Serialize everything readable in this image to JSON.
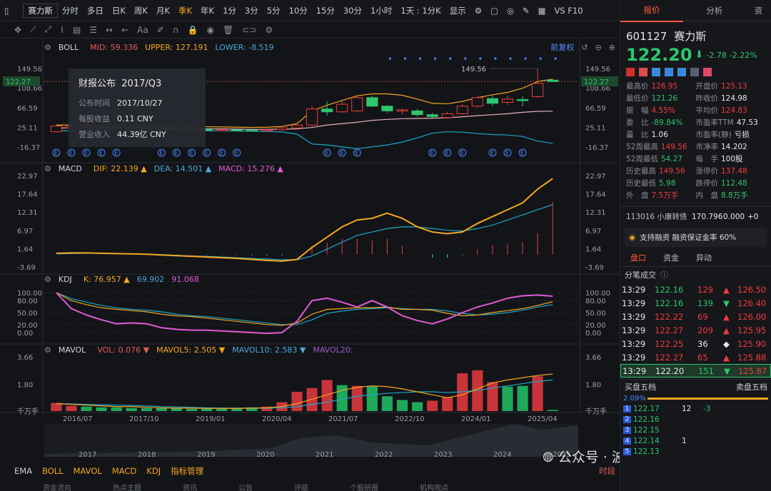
{
  "topbar": {
    "stock_name": "赛力斯",
    "periods": [
      "分时",
      "多日",
      "日K",
      "周K",
      "月K",
      "季K",
      "年K",
      "1分",
      "3分",
      "5分",
      "10分",
      "15分",
      "30分",
      "1小时",
      "1天 : 1分K",
      "显示"
    ],
    "active_period": "季K",
    "vs_label": "VS F10"
  },
  "toolbar": {
    "aa_label": "Aa"
  },
  "boll": {
    "name": "BOLL",
    "mid_label": "MID:",
    "mid": "59.336",
    "upper_label": "UPPER:",
    "upper": "127.191",
    "lower_label": "LOWER:",
    "lower": "-8.519",
    "fq_label": "前复权"
  },
  "tooltip": {
    "title": "财报公布",
    "period": "2017/Q3",
    "rows": [
      [
        "公布时间",
        "2017/10/27"
      ],
      [
        "每股收益",
        "0.11 CNY"
      ],
      [
        "营业收入",
        "44.39亿 CNY"
      ]
    ]
  },
  "macd": {
    "name": "MACD",
    "dif_label": "DIF:",
    "dif": "22.139",
    "dea_label": "DEA:",
    "dea": "14.501",
    "macd_label": "MACD:",
    "macd": "15.276"
  },
  "kdj": {
    "name": "KDJ",
    "k_label": "K:",
    "k": "76.957",
    "d": "69.902",
    "j": "91.068"
  },
  "mavol": {
    "name": "MAVOL",
    "vol_label": "VOL:",
    "vol": "0.076",
    "ma5_label": "MAVOL5:",
    "ma5": "2.505",
    "ma10_label": "MAVOL10:",
    "ma10": "2.583",
    "ma20_label": "MAVOL20:",
    "unit": "千万手"
  },
  "axes": {
    "price_ticks": [
      "149.56",
      "122.27",
      "108.66",
      "66.59",
      "25.11",
      "-16.37"
    ],
    "price_marker": "122.27",
    "peak_label": "149.56",
    "macd_ticks": [
      "22.97",
      "17.64",
      "12.31",
      "6.97",
      "1.64",
      "-3.69"
    ],
    "kdj_ticks": [
      "100.00",
      "80.00",
      "50.00",
      "20.00",
      "0.00"
    ],
    "vol_ticks": [
      "3.66",
      "1.80",
      "千万手"
    ],
    "date_ticks": [
      "2016/07",
      "2017/10",
      "2019/01",
      "2020/04",
      "2021/07",
      "2022/10",
      "2024/01",
      "2025/04"
    ],
    "nav_years": [
      "2017",
      "2018",
      "2019",
      "2020",
      "2021",
      "2022",
      "2023",
      "2024",
      "2025"
    ]
  },
  "bottombar": {
    "items": [
      "EMA",
      "BOLL",
      "MAVOL",
      "MACD",
      "KDJ",
      "指标管理"
    ],
    "right_label": "时段"
  },
  "bottom_tabs": [
    "资金流向",
    "热点主题",
    "资讯",
    "公告",
    "评级",
    "个股研报",
    "机构观点"
  ],
  "watermark": "公众号 · 波段肺鱼",
  "right": {
    "tabs": [
      "报价",
      "分析",
      "资"
    ],
    "code": "601127",
    "name": "赛力斯",
    "price": "122.20",
    "arrow": "⬇",
    "change": "-2.78",
    "change_pct": "-2.22%",
    "quote": [
      [
        "最高价",
        "126.95",
        "red",
        "开盘价",
        "125.13",
        "red"
      ],
      [
        "最低价",
        "121.26",
        "green",
        "昨收价",
        "124.98",
        "white"
      ],
      [
        "振　幅",
        "4.55%",
        "red",
        "平均价",
        "124.83",
        "red"
      ],
      [
        "委　比",
        "-89.84%",
        "green",
        "市盈率TTM",
        "47.53",
        "white"
      ],
      [
        "量　比",
        "1.06",
        "white",
        "市盈率(静)",
        "亏损",
        "white"
      ],
      [
        "52周最高",
        "149.56",
        "red",
        "市净率",
        "14.202",
        "white"
      ],
      [
        "52周最低",
        "54.27",
        "green",
        "每　手",
        "100股",
        "white"
      ],
      [
        "历史最高",
        "149.56",
        "red",
        "涨停价",
        "137.48",
        "red"
      ],
      [
        "历史最低",
        "5.98",
        "green",
        "跌停价",
        "112.48",
        "green"
      ],
      [
        "外　盘",
        "7.5万手",
        "red",
        "内　盘",
        "8.8万手",
        "green"
      ]
    ],
    "bond": [
      "113016 小康转债",
      "170.796",
      "0.000",
      "+0"
    ],
    "margin_text": "支持融资 融资保证金率 60%",
    "subtabs": [
      "盘口",
      "资金",
      "异动"
    ],
    "trades_title": "分笔成交",
    "trades": [
      [
        "13:29",
        "122.16",
        "129",
        "▲",
        "126.50"
      ],
      [
        "13:29",
        "122.16",
        "139",
        "▼",
        "126.40"
      ],
      [
        "13:29",
        "122.22",
        "69",
        "▲",
        "126.00"
      ],
      [
        "13:29",
        "122.27",
        "209",
        "▲",
        "125.95"
      ],
      [
        "13:29",
        "122.25",
        "36",
        "◆",
        "125.90"
      ],
      [
        "13:29",
        "122.27",
        "65",
        "▲",
        "125.88"
      ],
      [
        "13:29",
        "122.20",
        "151",
        "▼",
        "125.87"
      ]
    ],
    "bid_title": "买盘五档",
    "ask_title": "卖盘五档",
    "bid_ratio": "2.09%",
    "bids": [
      [
        "1",
        "122.17",
        "12",
        "-3"
      ],
      [
        "2",
        "122.16",
        "",
        ""
      ],
      [
        "3",
        "122.15",
        "",
        ""
      ],
      [
        "4",
        "122.14",
        "1",
        ""
      ],
      [
        "5",
        "122.13",
        "",
        ""
      ]
    ]
  },
  "chart_data": {
    "type": "candlestick",
    "candles": [
      {
        "o": 16,
        "c": 28,
        "h": 30,
        "l": 14
      },
      {
        "o": 24,
        "c": 27,
        "h": 29,
        "l": 22
      },
      {
        "o": 26,
        "c": 26.5,
        "h": 28,
        "l": 24
      },
      {
        "o": 26,
        "c": 25.5,
        "h": 27,
        "l": 24
      },
      {
        "o": 25,
        "c": 24.5,
        "h": 26,
        "l": 23
      },
      {
        "o": 24,
        "c": 24,
        "h": 25,
        "l": 23
      },
      {
        "o": 24,
        "c": 23,
        "h": 25,
        "l": 22
      },
      {
        "o": 23,
        "c": 22,
        "h": 24,
        "l": 21
      },
      {
        "o": 22,
        "c": 21.5,
        "h": 23,
        "l": 20
      },
      {
        "o": 21,
        "c": 21,
        "h": 22,
        "l": 20
      },
      {
        "o": 21,
        "c": 20,
        "h": 22,
        "l": 19
      },
      {
        "o": 20,
        "c": 20.5,
        "h": 21.5,
        "l": 19
      },
      {
        "o": 20,
        "c": 19.5,
        "h": 21,
        "l": 18.5
      },
      {
        "o": 19.5,
        "c": 19,
        "h": 20.5,
        "l": 18
      },
      {
        "o": 19,
        "c": 20,
        "h": 21,
        "l": 18.5
      },
      {
        "o": 20,
        "c": 24,
        "h": 25,
        "l": 19
      },
      {
        "o": 24,
        "c": 30,
        "h": 32,
        "l": 23
      },
      {
        "o": 30,
        "c": 64,
        "h": 70,
        "l": 28
      },
      {
        "o": 64,
        "c": 58,
        "h": 80,
        "l": 50
      },
      {
        "o": 58,
        "c": 74,
        "h": 80,
        "l": 56
      },
      {
        "o": 60,
        "c": 88,
        "h": 94,
        "l": 57
      },
      {
        "o": 88,
        "c": 70,
        "h": 92,
        "l": 68
      },
      {
        "o": 70,
        "c": 60,
        "h": 72,
        "l": 56
      },
      {
        "o": 60,
        "c": 62,
        "h": 66,
        "l": 52
      },
      {
        "o": 60,
        "c": 52,
        "h": 64,
        "l": 48
      },
      {
        "o": 52,
        "c": 48,
        "h": 56,
        "l": 45
      },
      {
        "o": 46,
        "c": 54,
        "h": 58,
        "l": 44
      },
      {
        "o": 54,
        "c": 70,
        "h": 74,
        "l": 52
      },
      {
        "o": 70,
        "c": 88,
        "h": 92,
        "l": 66
      },
      {
        "o": 86,
        "c": 76,
        "h": 94,
        "l": 70
      },
      {
        "o": 78,
        "c": 85,
        "h": 92,
        "l": 72
      },
      {
        "o": 84,
        "c": 82,
        "h": 90,
        "l": 70
      },
      {
        "o": 90,
        "c": 118,
        "h": 150,
        "l": 88
      },
      {
        "o": 125,
        "c": 122,
        "h": 127,
        "l": 121
      }
    ],
    "boll_mid": [
      24,
      24,
      24.5,
      24.5,
      24.3,
      24.2,
      24,
      23.5,
      23,
      22.5,
      22.2,
      22,
      21.5,
      21,
      21,
      21.3,
      22,
      25,
      30,
      33,
      36,
      40,
      42,
      43.5,
      44,
      44.5,
      45.5,
      47.5,
      50,
      52,
      54,
      57,
      59,
      59.3
    ],
    "boll_upper": [
      30,
      30,
      29.5,
      29,
      29,
      28.5,
      28,
      27.5,
      27,
      27,
      26.5,
      26,
      25.5,
      25,
      25.5,
      27,
      33,
      60,
      72,
      82,
      92,
      96,
      96,
      93,
      85,
      76,
      75,
      80,
      88,
      94,
      99,
      108,
      122,
      127.2
    ],
    "boll_lower": [
      18,
      18,
      19,
      19.5,
      19.5,
      19.8,
      20,
      19.5,
      19,
      18,
      18,
      18,
      17.5,
      17,
      16.5,
      15.5,
      11,
      -10,
      -12,
      -16,
      -20,
      -16,
      -12,
      -6,
      3,
      13,
      16,
      15,
      12,
      10,
      9,
      6,
      -4,
      -8.5
    ],
    "macd_dif": [
      0.3,
      0.4,
      0.4,
      0.3,
      0.2,
      0.1,
      0,
      -0.2,
      -0.4,
      -0.6,
      -0.8,
      -1,
      -1.2,
      -1.5,
      -1.8,
      -2,
      -1.5,
      2,
      5,
      8,
      10,
      10.5,
      12,
      10.5,
      8,
      6.5,
      6,
      6.5,
      9,
      11,
      13,
      15,
      19,
      22.1
    ],
    "macd_dea": [
      0.1,
      0.2,
      0.3,
      0.3,
      0.2,
      0.1,
      0,
      -0.1,
      -0.3,
      -0.5,
      -0.6,
      -0.8,
      -1,
      -1.2,
      -1.4,
      -1.6,
      -1.6,
      -0.5,
      1.5,
      3.5,
      5.5,
      6.5,
      7.5,
      8,
      8,
      7.5,
      7,
      6.8,
      7.5,
      8.5,
      10,
      11.5,
      13,
      14.5
    ],
    "macd_hist": [
      0.1,
      0.1,
      0,
      0,
      0,
      0,
      0,
      -0.1,
      -0.1,
      -0.1,
      -0.2,
      -0.2,
      -0.2,
      -0.3,
      -0.4,
      -0.4,
      0.1,
      2.5,
      3.5,
      4.5,
      4.5,
      4,
      4.5,
      2.5,
      0,
      -1,
      -1,
      -0.3,
      1.5,
      2.5,
      3,
      3.5,
      6,
      15.3
    ],
    "kdj_k": [
      100,
      80,
      70,
      62,
      58,
      55,
      52,
      46,
      42,
      40,
      36,
      32,
      28,
      24,
      20,
      18,
      24,
      46,
      58,
      60,
      62,
      62,
      64,
      58,
      58,
      56,
      48,
      42,
      44,
      50,
      55,
      60,
      68,
      77
    ],
    "kdj_d": [
      100,
      85,
      76,
      68,
      62,
      58,
      56,
      52,
      46,
      42,
      40,
      36,
      32,
      28,
      24,
      20,
      20,
      32,
      48,
      54,
      58,
      60,
      62,
      60,
      58,
      58,
      54,
      48,
      44,
      46,
      50,
      56,
      64,
      70
    ],
    "kdj_j": [
      100,
      60,
      44,
      32,
      22,
      24,
      22,
      12,
      8,
      6,
      6,
      4,
      2,
      0,
      -2,
      0,
      28,
      80,
      86,
      76,
      64,
      80,
      64,
      42,
      30,
      22,
      34,
      50,
      64,
      74,
      86,
      92,
      94,
      91
    ],
    "vol": [
      {
        "v": 0.55,
        "up": true
      },
      {
        "v": 0.35,
        "up": true
      },
      {
        "v": 0.3,
        "up": false
      },
      {
        "v": 0.25,
        "up": false
      },
      {
        "v": 0.25,
        "up": false
      },
      {
        "v": 0.2,
        "up": false
      },
      {
        "v": 0.2,
        "up": false
      },
      {
        "v": 0.2,
        "up": false
      },
      {
        "v": 0.2,
        "up": false
      },
      {
        "v": 0.15,
        "up": false
      },
      {
        "v": 0.15,
        "up": false
      },
      {
        "v": 0.15,
        "up": false
      },
      {
        "v": 0.2,
        "up": false
      },
      {
        "v": 0.25,
        "up": false
      },
      {
        "v": 0.3,
        "up": true
      },
      {
        "v": 0.6,
        "up": true
      },
      {
        "v": 1.3,
        "up": true
      },
      {
        "v": 1.55,
        "up": true
      },
      {
        "v": 2.1,
        "up": true
      },
      {
        "v": 1.75,
        "up": false
      },
      {
        "v": 1.7,
        "up": true
      },
      {
        "v": 1.7,
        "up": false
      },
      {
        "v": 1.0,
        "up": false
      },
      {
        "v": 0.75,
        "up": false
      },
      {
        "v": 0.6,
        "up": false
      },
      {
        "v": 0.7,
        "up": true
      },
      {
        "v": 0.95,
        "up": true
      },
      {
        "v": 2.55,
        "up": true
      },
      {
        "v": 2.75,
        "up": true
      },
      {
        "v": 1.95,
        "up": true
      },
      {
        "v": 1.65,
        "up": false
      },
      {
        "v": 1.7,
        "up": false
      },
      {
        "v": 2.35,
        "up": true
      },
      {
        "v": 0.08,
        "up": false
      }
    ],
    "mavol5": [
      0.5,
      0.45,
      0.4,
      0.35,
      0.3,
      0.3,
      0.25,
      0.22,
      0.2,
      0.2,
      0.18,
      0.18,
      0.18,
      0.2,
      0.22,
      0.3,
      0.5,
      0.8,
      1.1,
      1.4,
      1.6,
      1.7,
      1.65,
      1.5,
      1.3,
      1.1,
      0.9,
      1.1,
      1.5,
      1.9,
      2.1,
      2.25,
      2.4,
      2.5
    ],
    "mavol10": [
      0.5,
      0.48,
      0.45,
      0.42,
      0.4,
      0.38,
      0.35,
      0.3,
      0.28,
      0.25,
      0.22,
      0.2,
      0.2,
      0.2,
      0.2,
      0.22,
      0.3,
      0.45,
      0.6,
      0.8,
      1.0,
      1.1,
      1.2,
      1.25,
      1.3,
      1.3,
      1.25,
      1.3,
      1.4,
      1.55,
      1.7,
      1.85,
      2.0,
      2.1
    ],
    "price_range": [
      -16.37,
      149.56
    ],
    "macd_range": [
      -3.69,
      22.97
    ],
    "vol_max": 3.66
  }
}
